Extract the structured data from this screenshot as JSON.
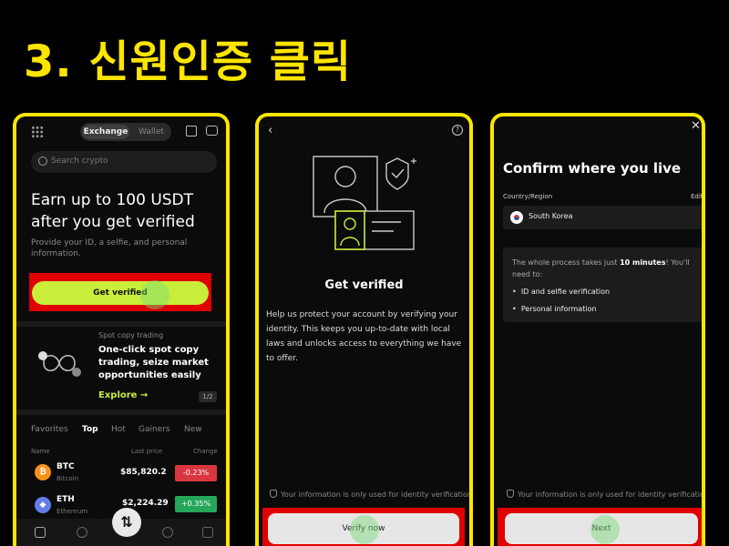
{
  "slide": {
    "title": "3. 신원인증 클릭"
  },
  "screen1": {
    "tabs": {
      "exchange": "Exchange",
      "wallet": "Wallet"
    },
    "search_placeholder": "Search crypto",
    "headline": "Earn up to 100 USDT after you get verified",
    "subline": "Provide your ID, a selfie, and personal information.",
    "cta_label": "Get verified",
    "promo": {
      "caption": "Spot copy trading",
      "text": "One-click spot copy trading, seize market opportunities easily",
      "link": "Explore →",
      "pager": "1/2"
    },
    "market_tabs": [
      "Favorites",
      "Top",
      "Hot",
      "Gainers",
      "New"
    ],
    "active_market_tab": "Top",
    "columns": {
      "name": "Name",
      "last_price": "Last price",
      "change": "Change"
    },
    "rows": [
      {
        "symbol": "BTC",
        "name": "Bitcoin",
        "price": "$85,820.2",
        "change": "-0.23%",
        "icon": "bitcoin-icon",
        "icon_glyph": "₿",
        "color": "#f7931a",
        "change_color": "#d9373f"
      },
      {
        "symbol": "ETH",
        "name": "Ethereum",
        "price": "$2,224.29",
        "change": "+0.35%",
        "icon": "ethereum-icon",
        "icon_glyph": "◆",
        "color": "#627eea",
        "change_color": "#26a65b"
      }
    ],
    "swap_glyph": "⇅",
    "accent_color": "#c8ee3a"
  },
  "screen2": {
    "back_glyph": "‹",
    "help_glyph": "?",
    "title": "Get verified",
    "body": "Help us protect your account by verifying your identity. This keeps you up-to-date with local laws and unlocks access to everything we have to offer.",
    "note": "Your information is only used for identity verification.",
    "button": "Verify now"
  },
  "screen3": {
    "close_glyph": "✕",
    "title": "Confirm where you live",
    "country_label": "Country/Region",
    "edit": "Edit",
    "country": "South Korea",
    "info_prefix": "The whole process takes just ",
    "info_bold": "10 minutes",
    "info_suffix": "! You'll need to:",
    "bullets": [
      "ID and selfie verification",
      "Personal information"
    ],
    "note": "Your information is only used for identity verification.",
    "button": "Next"
  },
  "colors": {
    "title_yellow": "#ffe500",
    "frame_yellow": "#ffe600",
    "highlight_red": "#e00000"
  }
}
